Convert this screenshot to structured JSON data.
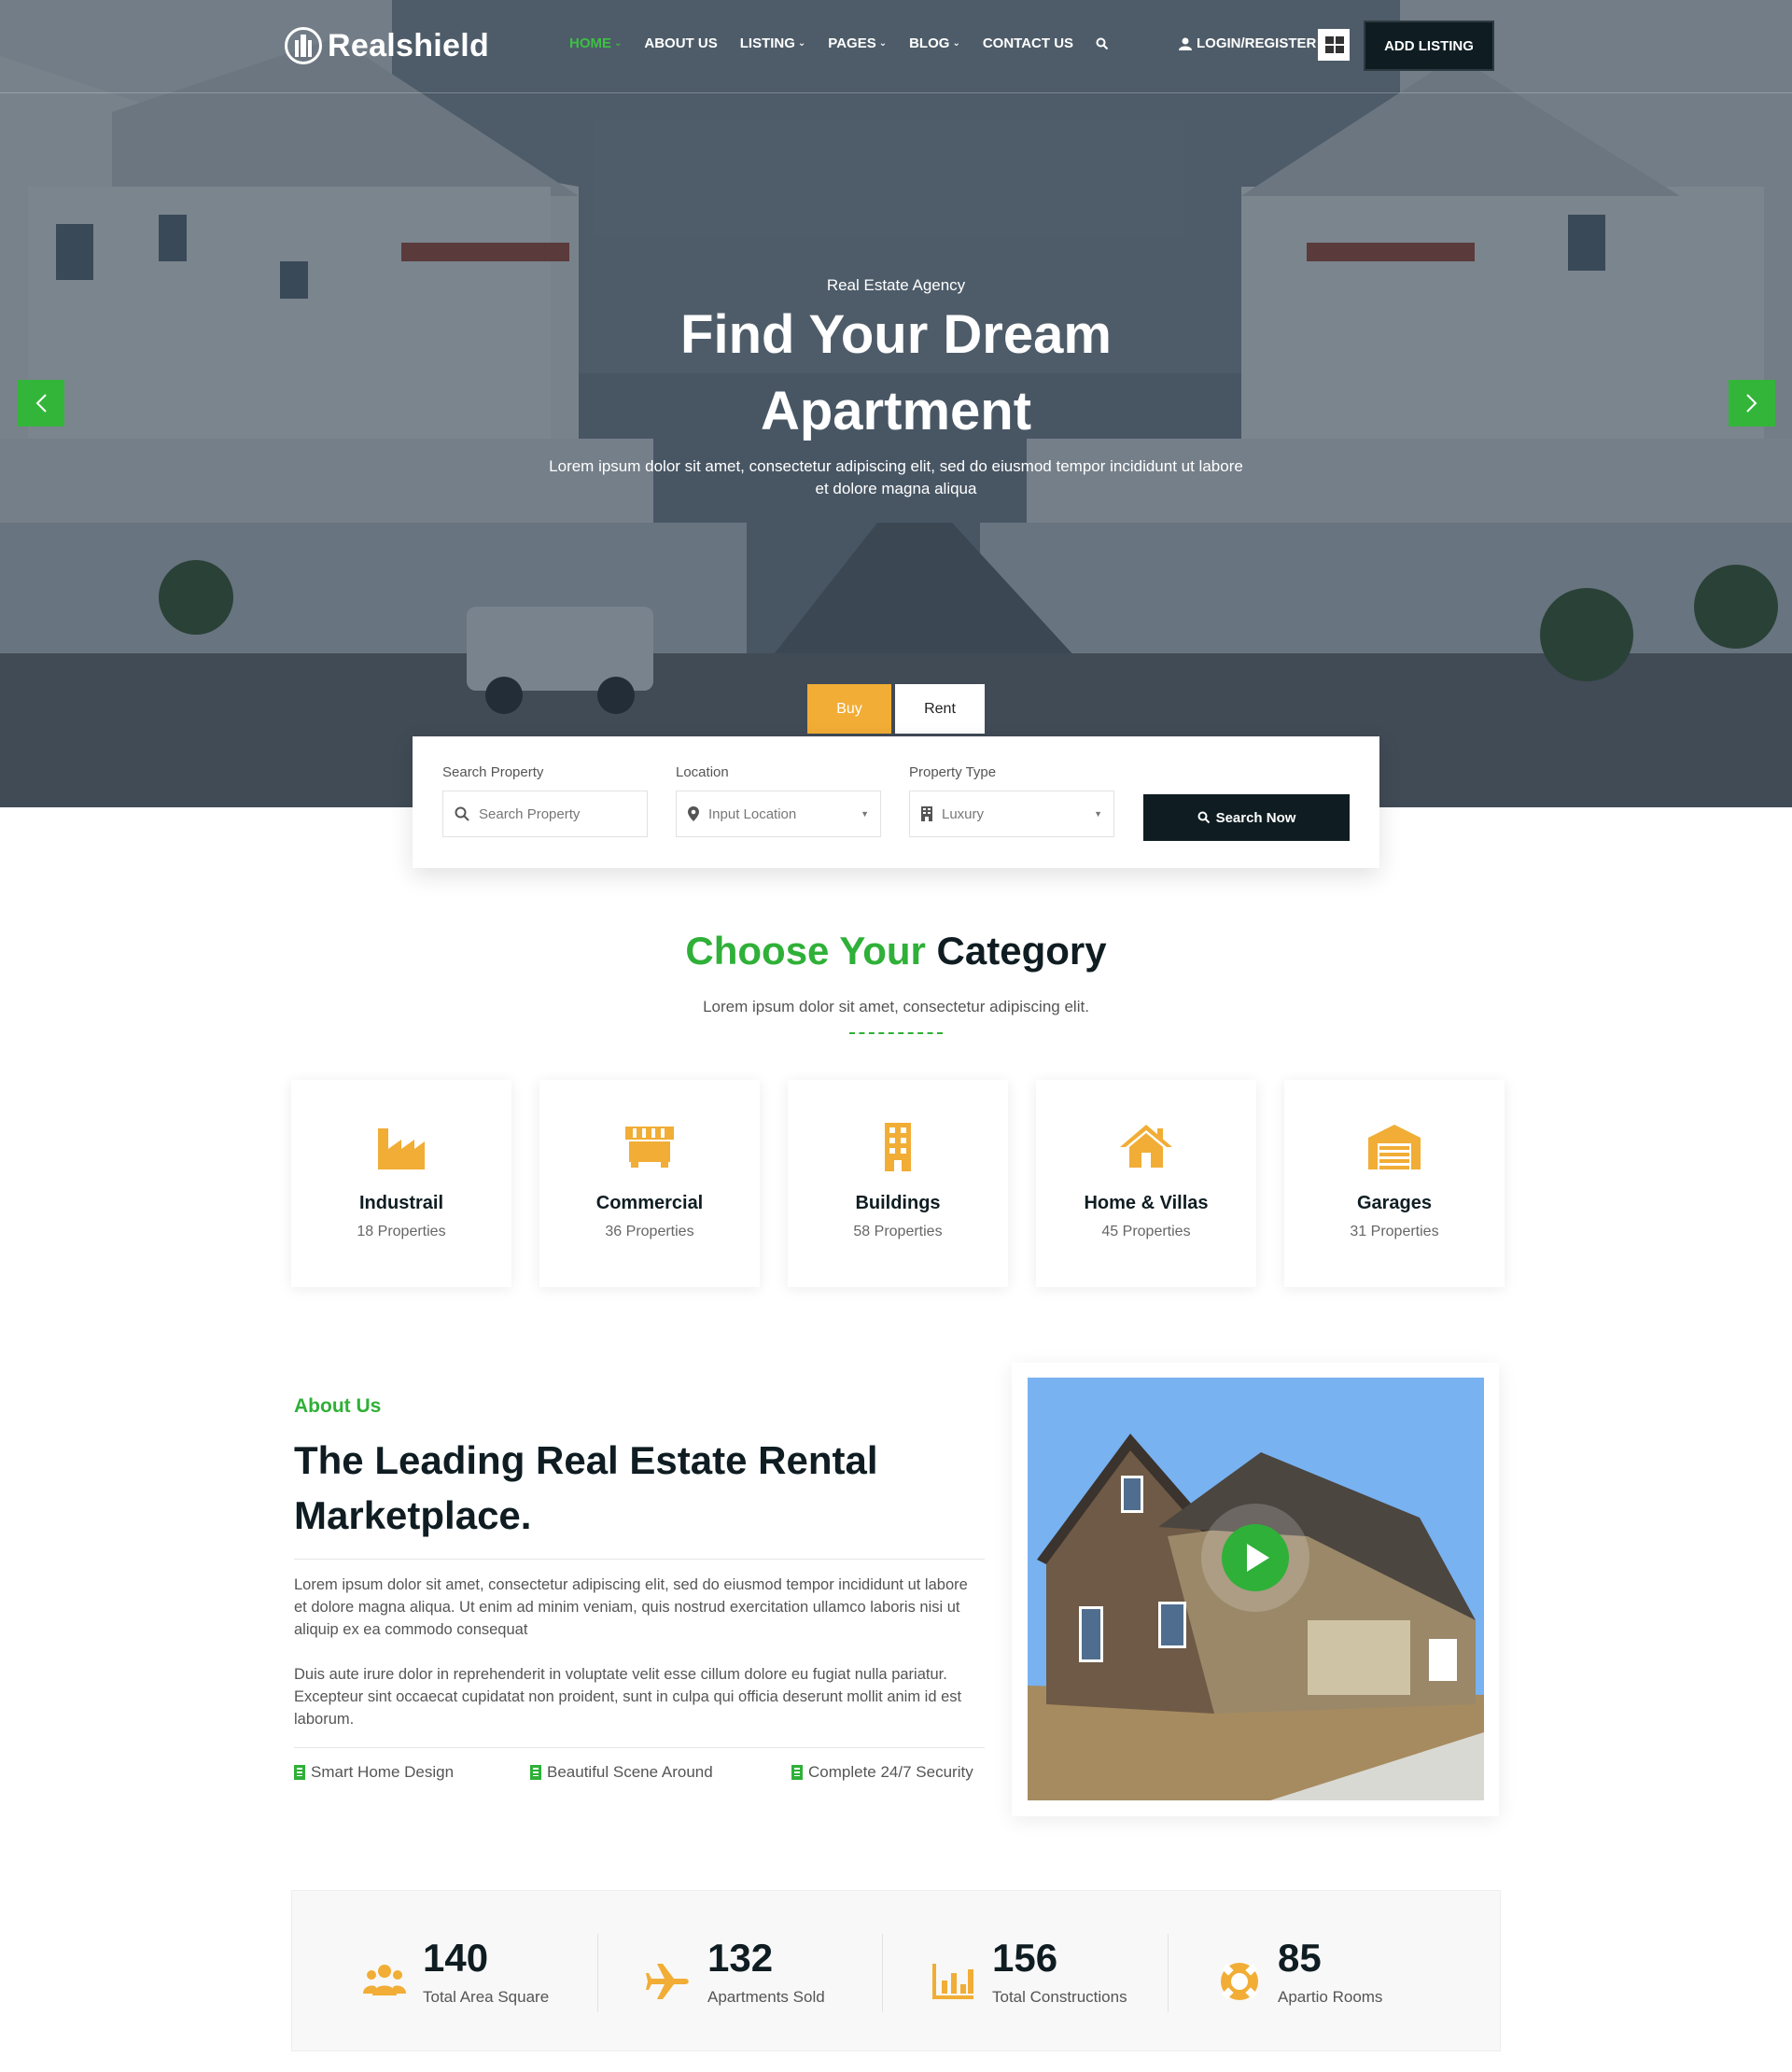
{
  "brand": {
    "name": "Realshield"
  },
  "nav": {
    "items": [
      {
        "label": "HOME",
        "dropdown": true,
        "active": true
      },
      {
        "label": "ABOUT US",
        "dropdown": false
      },
      {
        "label": "LISTING",
        "dropdown": true
      },
      {
        "label": "PAGES",
        "dropdown": true
      },
      {
        "label": "BLOG",
        "dropdown": true
      },
      {
        "label": "CONTACT US",
        "dropdown": false
      }
    ],
    "login_label": "LOGIN/REGISTER",
    "add_listing_label": "ADD LISTING"
  },
  "hero": {
    "eyebrow": "Real Estate Agency",
    "title_line1": "Find Your Dream",
    "title_line2": "Apartment",
    "description": "Lorem ipsum dolor sit amet, consectetur adipiscing elit, sed do eiusmod tempor incididunt ut labore et dolore magna aliqua"
  },
  "search": {
    "tabs": {
      "buy": "Buy",
      "rent": "Rent"
    },
    "property_label": "Search Property",
    "property_placeholder": "Search Property",
    "location_label": "Location",
    "location_value": "Input Location",
    "type_label": "Property Type",
    "type_value": "Luxury",
    "button_label": "Search Now"
  },
  "category": {
    "title_green": "Choose Your",
    "title_dark": "Category",
    "subtitle": "Lorem ipsum dolor sit amet, consectetur adipiscing elit.",
    "items": [
      {
        "name": "Industrail",
        "count": "18 Properties",
        "icon": "factory-icon"
      },
      {
        "name": "Commercial",
        "count": "36 Properties",
        "icon": "store-icon"
      },
      {
        "name": "Buildings",
        "count": "58 Properties",
        "icon": "building-icon"
      },
      {
        "name": "Home & Villas",
        "count": "45 Properties",
        "icon": "home-icon"
      },
      {
        "name": "Garages",
        "count": "31 Properties",
        "icon": "garage-icon"
      }
    ]
  },
  "about": {
    "eyebrow": "About Us",
    "title": "The Leading Real Estate Rental Marketplace.",
    "para1": "Lorem ipsum dolor sit amet, consectetur adipiscing elit, sed do eiusmod tempor incididunt ut labore et dolore magna aliqua. Ut enim ad minim veniam, quis nostrud exercitation ullamco laboris nisi ut aliquip ex ea commodo consequat",
    "para2": "Duis aute irure dolor in reprehenderit in voluptate velit esse cillum dolore eu fugiat nulla pariatur. Excepteur sint occaecat cupidatat non proident, sunt in culpa qui officia deserunt mollit anim id est laborum.",
    "features": [
      "Smart Home Design",
      "Beautiful Scene Around",
      "Complete 24/7 Security"
    ]
  },
  "stats": [
    {
      "value": "140",
      "label": "Total Area Square",
      "icon": "users-icon"
    },
    {
      "value": "132",
      "label": "Apartments Sold",
      "icon": "plane-icon"
    },
    {
      "value": "156",
      "label": "Total Constructions",
      "icon": "bar-chart-icon"
    },
    {
      "value": "85",
      "label": "Apartio Rooms",
      "icon": "life-ring-icon"
    }
  ],
  "colors": {
    "green": "#2fb038",
    "orange": "#f1ad35",
    "dark": "#0f1d22"
  }
}
